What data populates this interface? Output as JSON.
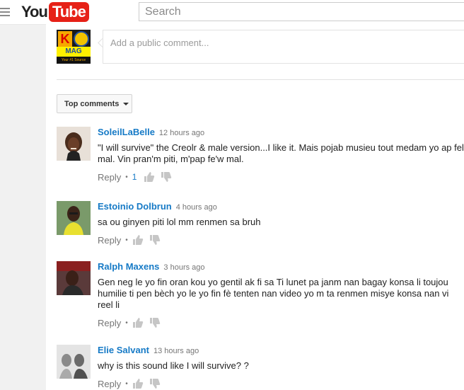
{
  "header": {
    "logo_you": "You",
    "logo_tube": "Tube",
    "search_placeholder": "Search"
  },
  "my_channel": {
    "avatar_letter": "K",
    "avatar_text": "MAG",
    "avatar_sub": "Your #1 Source"
  },
  "comment_box": {
    "placeholder": "Add a public comment..."
  },
  "sort": {
    "label": "Top comments"
  },
  "comments": [
    {
      "author": "SoleilLaBelle",
      "time": "12 hours ago",
      "text": "\"I will survive\" the Creolr & male version...I like it. Mais pojab musieu tout medam yo ap fel mal. Vin pran'm piti, m'pap fe'w mal.",
      "reply": "Reply",
      "likes": "1"
    },
    {
      "author": "Estoinio Dolbrun",
      "time": "4 hours ago",
      "text": "sa ou ginyen piti lol mm renmen sa bruh",
      "reply": "Reply",
      "likes": ""
    },
    {
      "author": "Ralph Maxens",
      "time": "3 hours ago",
      "text": "Gen neg le yo fin oran kou yo gentil ak fi sa Ti lunet pa janm nan bagay konsa li toujou humilie ti pen bèch yo le yo fin fè tenten nan video yo m ta renmen misye konsa nan vi reel li",
      "reply": "Reply",
      "likes": ""
    },
    {
      "author": "Elie Salvant",
      "time": "13 hours ago",
      "text": "why is this sound like I will survive? ?",
      "reply": "Reply",
      "likes": ""
    }
  ],
  "colors": {
    "author_link": "#167ac6",
    "logo_red": "#e62117"
  }
}
